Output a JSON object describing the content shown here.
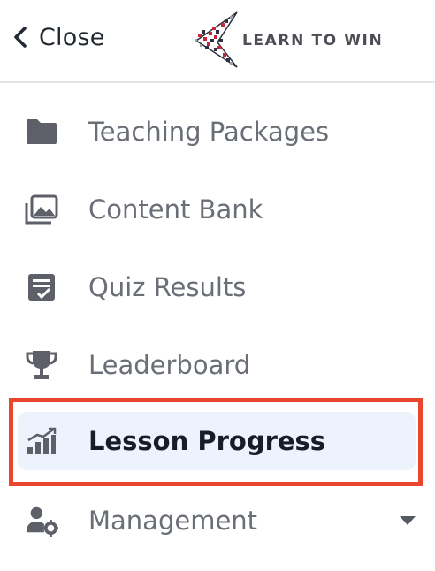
{
  "header": {
    "close_label": "Close",
    "close_icon": "chevron-left-icon",
    "logo_text": "LEARN TO WIN"
  },
  "nav": {
    "items": [
      {
        "label": "Teaching Packages",
        "icon": "folder-icon",
        "active": false
      },
      {
        "label": "Content Bank",
        "icon": "photo-library-icon",
        "active": false
      },
      {
        "label": "Quiz Results",
        "icon": "checklist-icon",
        "active": false
      },
      {
        "label": "Leaderboard",
        "icon": "trophy-icon",
        "active": false
      },
      {
        "label": "Lesson Progress",
        "icon": "progress-chart-icon",
        "active": true
      },
      {
        "label": "Management",
        "icon": "user-gear-icon",
        "active": false,
        "expandable": true
      }
    ]
  },
  "colors": {
    "active_bg": "#edf3fd",
    "highlight_border": "#e8472d",
    "icon_gray": "#5d6068",
    "text_gray": "#6a6e76",
    "active_text": "#171c26"
  }
}
